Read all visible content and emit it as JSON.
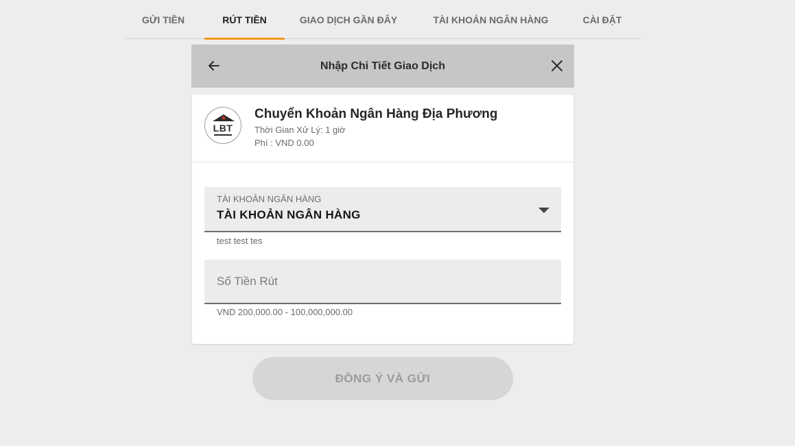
{
  "tabs": [
    {
      "label": "GỬI TIỀN",
      "active": false
    },
    {
      "label": "RÚT TIỀN",
      "active": true
    },
    {
      "label": "GIAO DỊCH GẦN ĐÂY",
      "active": false
    },
    {
      "label": "TÀI KHOẢN NGÂN HÀNG",
      "active": false
    },
    {
      "label": "CÀI ĐẶT",
      "active": false
    }
  ],
  "header": {
    "title": "Nhập Chi Tiết Giao Dịch",
    "back_icon": "arrow-left-icon",
    "close_icon": "close-icon"
  },
  "method": {
    "logo_text": "LBT",
    "title": "Chuyển Khoản Ngân Hàng Địa Phương",
    "processing_time": "Thời Gian Xử Lý: 1 giờ",
    "fee": "Phí : VND 0.00"
  },
  "bank_account_field": {
    "label": "TÀI KHOẢN NGÂN HÀNG",
    "value": "TÀI KHOẢN NGÂN HÀNG",
    "helper": "test test tes"
  },
  "amount_field": {
    "placeholder": "Số Tiền Rút",
    "value": "",
    "helper": "VND 200,000.00 - 100,000,000.00"
  },
  "submit_label": "ĐỒNG Ý VÀ GỬI",
  "colors": {
    "accent": "#f29a1f",
    "background": "#ededed",
    "header_bg": "#c6c6c6",
    "button_disabled": "#d6d6d6",
    "logo_star": "#e23a2a"
  }
}
